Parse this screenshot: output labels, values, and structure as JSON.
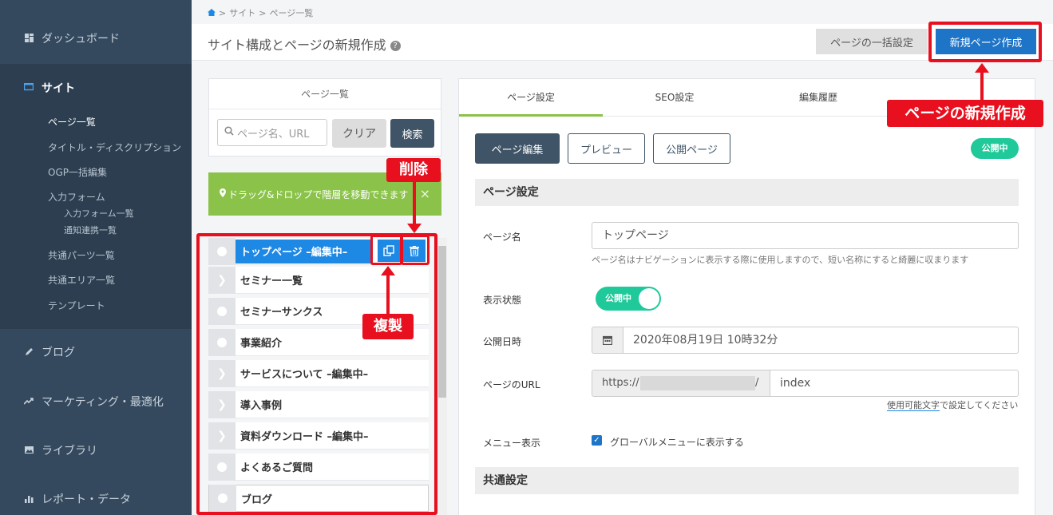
{
  "sidebar": {
    "dashboard": "ダッシュボード",
    "site": "サイト",
    "sub": {
      "page_list": "ページ一覧",
      "title_desc": "タイトル・ディスクリプション",
      "ogp": "OGP一括編集",
      "form": "入力フォーム",
      "form_list": "入力フォーム一覧",
      "notify": "通知連携一覧",
      "parts": "共通パーツ一覧",
      "area": "共通エリア一覧",
      "template": "テンプレート"
    },
    "blog": "ブログ",
    "marketing": "マーケティング・最適化",
    "library": "ライブラリ",
    "report": "レポート・データ"
  },
  "breadcrumb": {
    "home_icon": "home-icon",
    "sep": ">",
    "site": "サイト",
    "page_list": "ページ一覧"
  },
  "header": {
    "title": "サイト構成とページの新規作成",
    "help": "?",
    "bulk_button": "ページの一括設定",
    "new_button": "新規ページ作成"
  },
  "left": {
    "list_title": "ページ一覧",
    "search_placeholder": "ページ名、URL",
    "clear": "クリア",
    "search": "検索",
    "dnd_note": "ドラッグ&ドロップで階層を移動できます",
    "close": "×",
    "pages": [
      {
        "label": "トップページ –編集中–",
        "type": "dot"
      },
      {
        "label": "セミナー一覧",
        "type": "chev"
      },
      {
        "label": "セミナーサンクス",
        "type": "dot"
      },
      {
        "label": "事業紹介",
        "type": "dot"
      },
      {
        "label": "サービスについて –編集中–",
        "type": "chev"
      },
      {
        "label": "導入事例",
        "type": "chev"
      },
      {
        "label": "資料ダウンロード –編集中–",
        "type": "chev"
      },
      {
        "label": "よくあるご質問",
        "type": "dot"
      },
      {
        "label": "ブログ",
        "type": "dot"
      }
    ]
  },
  "tabs": [
    "ページ設定",
    "SEO設定",
    "編集履歴"
  ],
  "actions": {
    "edit": "ページ編集",
    "preview": "プレビュー",
    "public": "公開ページ",
    "status": "公開中"
  },
  "form": {
    "section_page": "ページ設定",
    "name_label": "ページ名",
    "name_value": "トップページ",
    "name_help": "ページ名はナビゲーションに表示する際に使用しますので、短い名称にすると綺麗に収まります",
    "display_label": "表示状態",
    "toggle_text": "公開中",
    "date_label": "公開日時",
    "date_value": "2020年08月19日 10時32分",
    "url_label": "ページのURL",
    "url_prefix": "https://",
    "url_slash": "/",
    "url_value": "index",
    "url_help_link": "使用可能文字",
    "url_help_rest": "で設定してください",
    "menu_label": "メニュー表示",
    "menu_check": "グローバルメニューに表示する",
    "section_common": "共通設定"
  },
  "annotations": {
    "delete": "削除",
    "duplicate": "複製",
    "new_page": "ページの新規作成"
  },
  "colors": {
    "sidebar": "#34495e",
    "primary": "#1e74c6",
    "accent_green": "#8bc34a",
    "status_green": "#1fc99a",
    "annotation_red": "#e8101e"
  }
}
